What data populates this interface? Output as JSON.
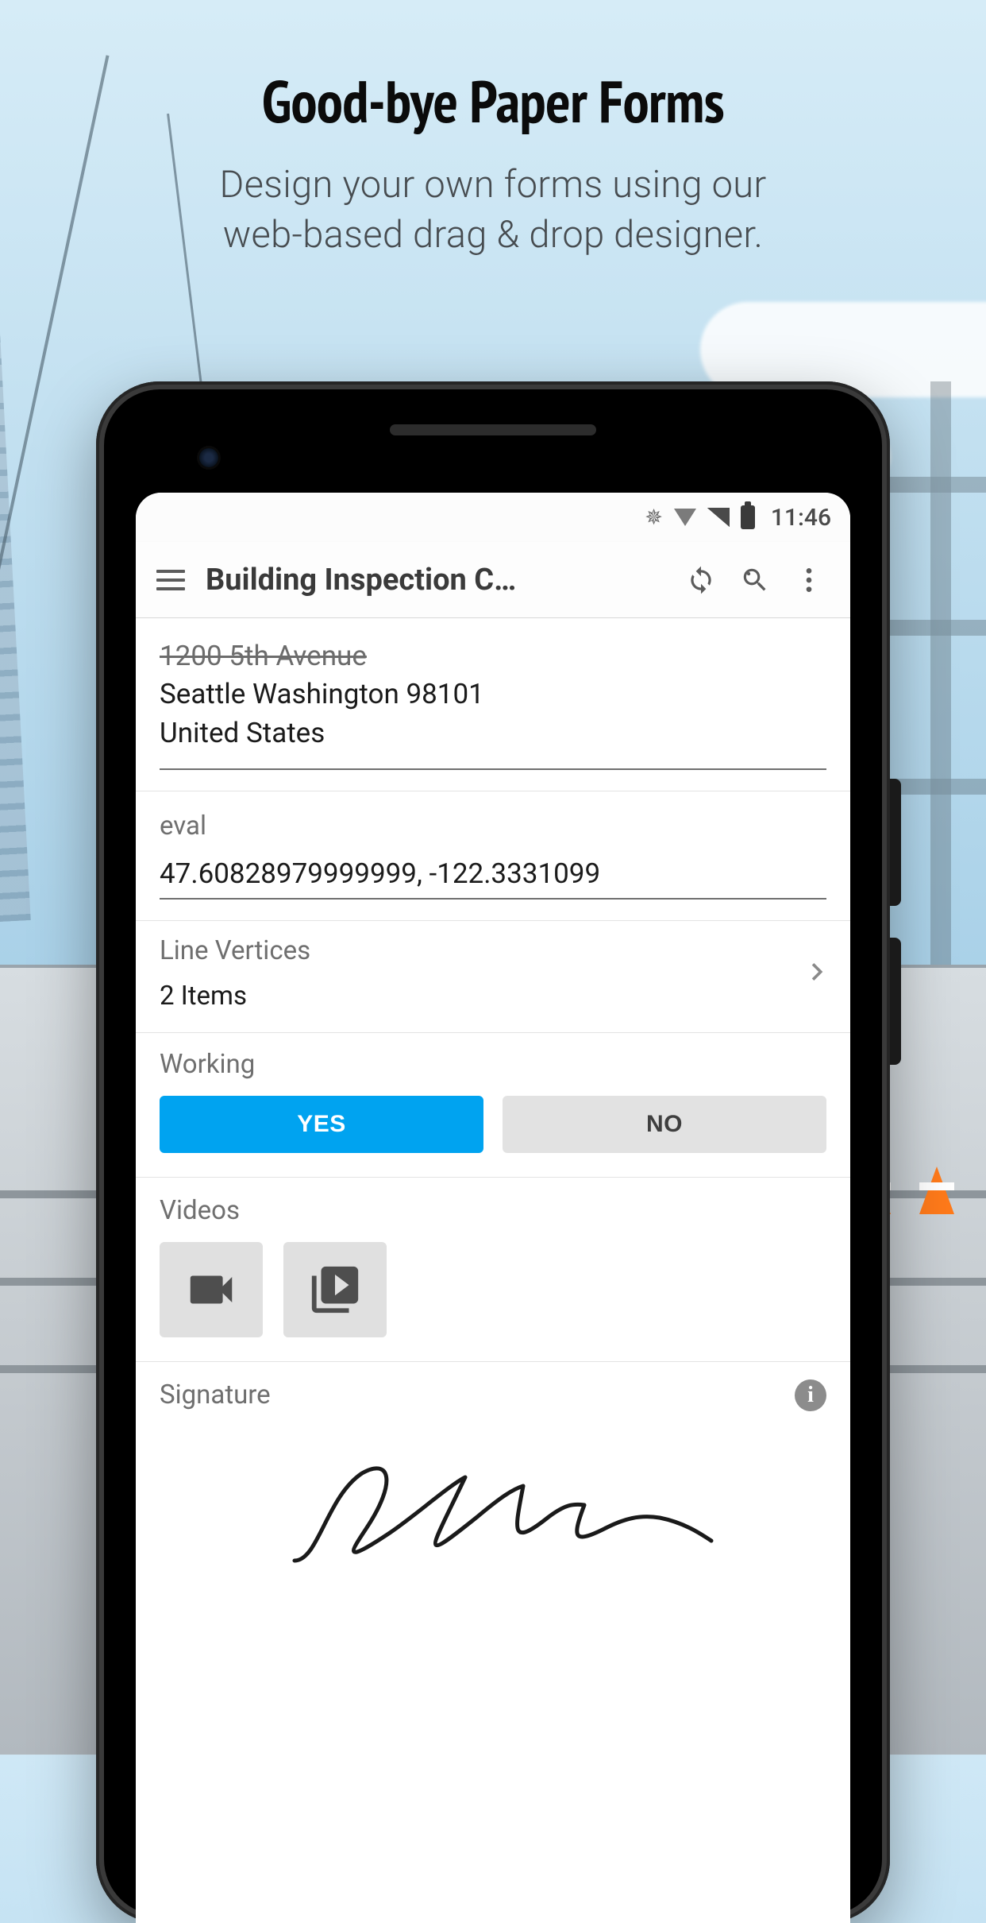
{
  "promo": {
    "headline": "Good-bye Paper Forms",
    "subline1": "Design your own forms using our",
    "subline2": "web-based drag & drop designer."
  },
  "statusbar": {
    "time": "11:46"
  },
  "appbar": {
    "title": "Building Inspection C…"
  },
  "form": {
    "address": {
      "line0_strike": "1200 5th Avenue",
      "line1": "Seattle Washington 98101",
      "line2": "United States"
    },
    "eval": {
      "label": "eval",
      "value": "47.60828979999999, -122.3331099"
    },
    "line_vertices": {
      "label": "Line Vertices",
      "summary": "2 Items"
    },
    "working": {
      "label": "Working",
      "yes_label": "YES",
      "no_label": "NO",
      "selected": "yes"
    },
    "videos": {
      "label": "Videos"
    },
    "signature": {
      "label": "Signature"
    }
  }
}
